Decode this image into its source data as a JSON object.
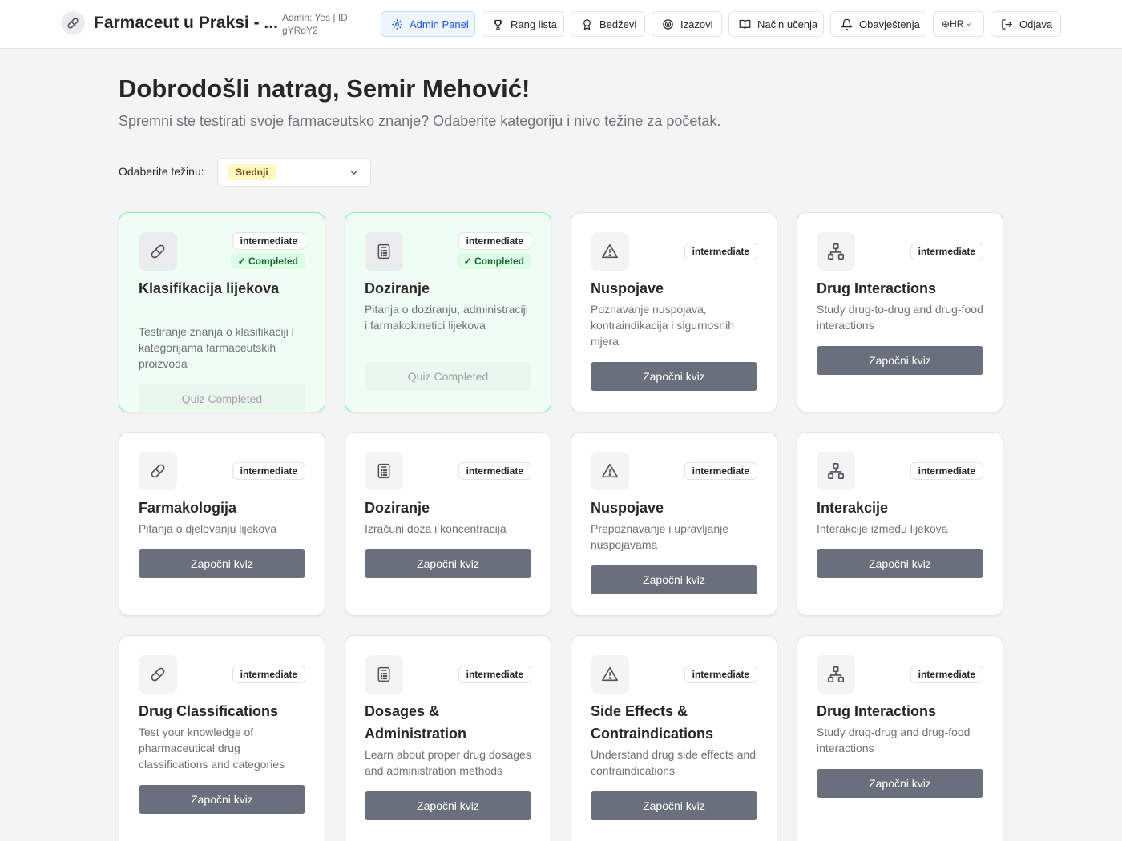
{
  "header": {
    "app_title": "Farmaceut u Praksi - ...",
    "admin_line1": "Admin: Yes | ID:",
    "admin_line2": "gYRdY2",
    "nav": {
      "admin_panel": "Admin Panel",
      "leaderboard": "Rang lista",
      "badges": "Bedževi",
      "challenges": "Izazovi",
      "learning_mode": "Način učenja",
      "notifications": "Obavještenja",
      "language": "HR",
      "logout": "Odjava"
    }
  },
  "main": {
    "welcome": "Dobrodošli natrag, Semir Mehović!",
    "subtitle": "Spremni ste testirati svoje farmaceutsko znanje? Odaberite kategoriju i nivo težine za početak.",
    "difficulty_label": "Odaberite težinu:",
    "difficulty_value": "Srednji"
  },
  "cards": [
    {
      "icon": "pill-icon",
      "level": "intermediate",
      "completed": true,
      "completed_label": "✓ Completed",
      "title": "Klasifikacija lijekova",
      "desc": "Testiranje znanja o klasifikaciji i kategorijama farmaceutskih proizvoda",
      "button": "Quiz Completed"
    },
    {
      "icon": "calculator-icon",
      "level": "intermediate",
      "completed": true,
      "completed_label": "✓ Completed",
      "title": "Doziranje",
      "desc": "Pitanja o doziranju, administraciji i farmakokinetici lijekova",
      "button": "Quiz Completed"
    },
    {
      "icon": "warning-icon",
      "level": "intermediate",
      "completed": false,
      "title": "Nuspojave",
      "desc": "Poznavanje nuspojava, kontraindikacija i sigurnosnih mjera",
      "button": "Započni kviz"
    },
    {
      "icon": "network-icon",
      "level": "intermediate",
      "completed": false,
      "title": "Drug Interactions",
      "desc": "Study drug-to-drug and drug-food interactions",
      "button": "Započni kviz"
    },
    {
      "icon": "pill-icon",
      "level": "intermediate",
      "completed": false,
      "title": "Farmakologija",
      "desc": "Pitanja o djelovanju lijekova",
      "button": "Započni kviz"
    },
    {
      "icon": "calculator-icon",
      "level": "intermediate",
      "completed": false,
      "title": "Doziranje",
      "desc": "Izračuni doza i koncentracija",
      "button": "Započni kviz"
    },
    {
      "icon": "warning-icon",
      "level": "intermediate",
      "completed": false,
      "title": "Nuspojave",
      "desc": "Prepoznavanje i upravljanje nuspojavama",
      "button": "Započni kviz"
    },
    {
      "icon": "network-icon",
      "level": "intermediate",
      "completed": false,
      "title": "Interakcije",
      "desc": "Interakcije između lijekova",
      "button": "Započni kviz"
    },
    {
      "icon": "pill-icon",
      "level": "intermediate",
      "completed": false,
      "title": "Drug Classifications",
      "desc": "Test your knowledge of pharmaceutical drug classifications and categories",
      "button": "Započni kviz"
    },
    {
      "icon": "calculator-icon",
      "level": "intermediate",
      "completed": false,
      "title": "Dosages & Administration",
      "desc": "Learn about proper drug dosages and administration methods",
      "button": "Započni kviz"
    },
    {
      "icon": "warning-icon",
      "level": "intermediate",
      "completed": false,
      "title": "Side Effects & Contraindications",
      "desc": "Understand drug side effects and contraindications",
      "button": "Započni kviz"
    },
    {
      "icon": "network-icon",
      "level": "intermediate",
      "completed": false,
      "title": "Drug Interactions",
      "desc": "Study drug-drug and drug-food interactions",
      "button": "Započni kviz"
    }
  ]
}
